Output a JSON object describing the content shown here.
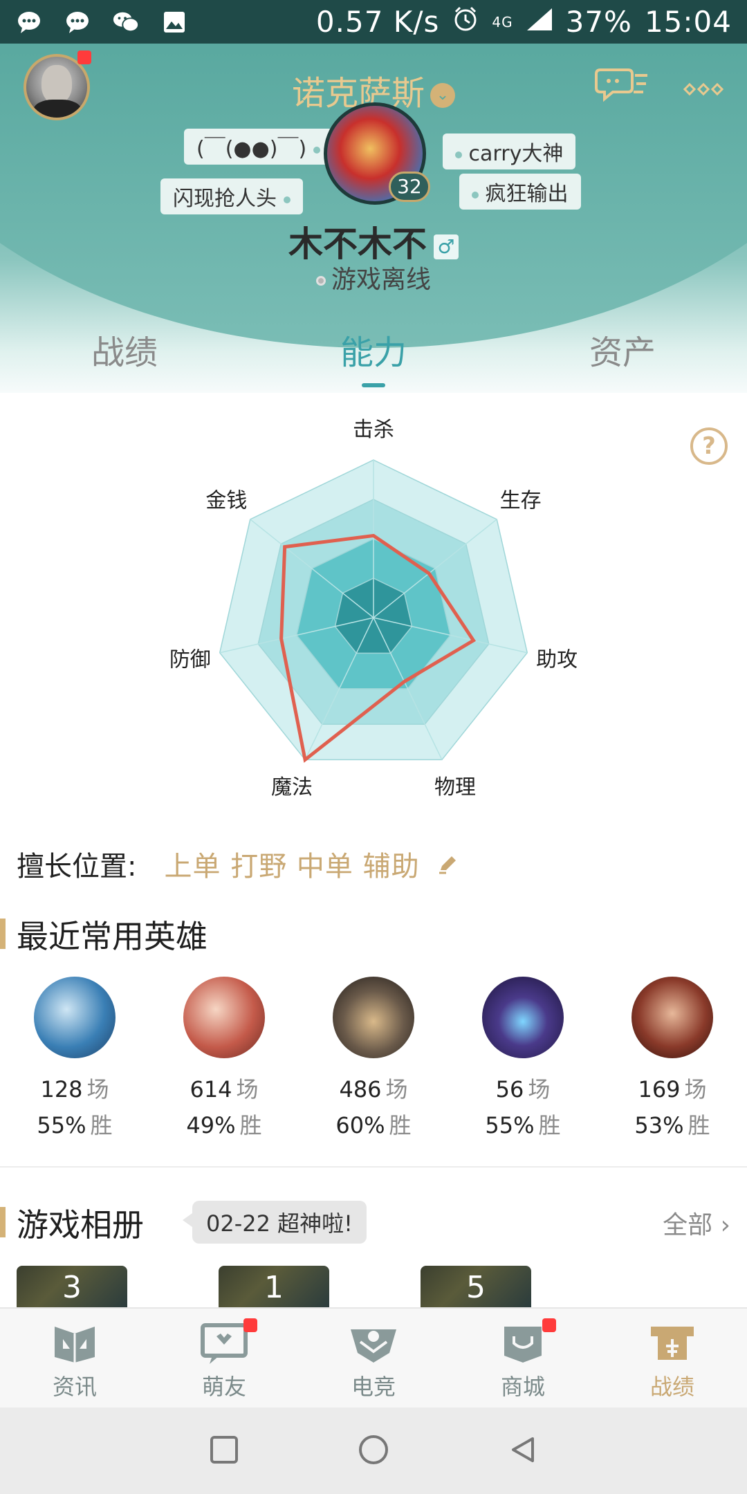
{
  "status_bar": {
    "speed": "0.57 K/s",
    "network": "4G",
    "battery": "37%",
    "time": "15:04",
    "icons": [
      "message-icon",
      "message-icon",
      "wechat-icon",
      "gallery-icon",
      "alarm-icon",
      "signal-icon",
      "battery-icon"
    ]
  },
  "header": {
    "server_name": "诺克萨斯",
    "tags": [
      "(￣(●●)￣)",
      "闪现抢人头",
      "carry大神",
      "疯狂输出"
    ],
    "level": "32",
    "player_name": "木不木不",
    "gender_symbol": "♂",
    "status": "游戏离线"
  },
  "tabs": [
    {
      "label": "战绩",
      "active": false
    },
    {
      "label": "能力",
      "active": true
    },
    {
      "label": "资产",
      "active": false
    }
  ],
  "help_symbol": "?",
  "chart_data": {
    "type": "radar",
    "axes": [
      "击杀",
      "生存",
      "助攻",
      "物理",
      "魔法",
      "防御",
      "金钱"
    ],
    "values": [
      0.52,
      0.45,
      0.65,
      0.45,
      1.0,
      0.6,
      0.72
    ],
    "range": [
      0,
      1
    ],
    "levels": 4,
    "series_color": "#e0604f"
  },
  "positions": {
    "label": "擅长位置:",
    "values": "上单 打野 中单 辅助"
  },
  "recent_heroes": {
    "title": "最近常用英雄",
    "heroes": [
      {
        "games": "128",
        "unit_games": "场",
        "win": "55%",
        "unit_win": "胜",
        "color": "#3a7fb5"
      },
      {
        "games": "614",
        "unit_games": "场",
        "win": "49%",
        "unit_win": "胜",
        "color": "#c45a4a"
      },
      {
        "games": "486",
        "unit_games": "场",
        "win": "60%",
        "unit_win": "胜",
        "color": "#6a5a4a"
      },
      {
        "games": "56",
        "unit_games": "场",
        "win": "55%",
        "unit_win": "胜",
        "color": "#4a3a8a"
      },
      {
        "games": "169",
        "unit_games": "场",
        "win": "53%",
        "unit_win": "胜",
        "color": "#8a3a2a"
      }
    ]
  },
  "album": {
    "title": "游戏相册",
    "bubble": "02-22 超神啦!",
    "all_label": "全部",
    "thumbs": [
      "3",
      "1",
      "5"
    ]
  },
  "bottom_nav": [
    {
      "label": "资讯",
      "icon": "news-icon",
      "badge": false,
      "active": false
    },
    {
      "label": "萌友",
      "icon": "friends-icon",
      "badge": true,
      "active": false
    },
    {
      "label": "电竞",
      "icon": "esports-icon",
      "badge": false,
      "active": false
    },
    {
      "label": "商城",
      "icon": "shop-icon",
      "badge": true,
      "active": false
    },
    {
      "label": "战绩",
      "icon": "record-icon",
      "badge": false,
      "active": true
    }
  ],
  "colors": {
    "accent": "#3aa1a8",
    "gold": "#c9a873",
    "badge": "#ff3b3b"
  }
}
